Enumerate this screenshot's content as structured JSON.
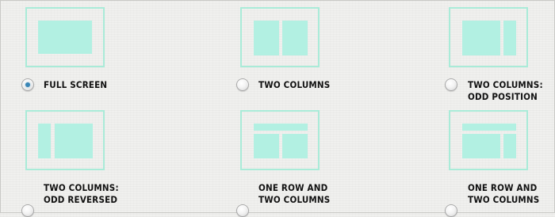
{
  "layouts": [
    {
      "label_line1": "FULL SCREEN",
      "label_line2": "",
      "selected": true
    },
    {
      "label_line1": "TWO COLUMNS",
      "label_line2": "",
      "selected": false
    },
    {
      "label_line1": "TWO COLUMNS:",
      "label_line2": "ODD POSITION",
      "selected": false
    },
    {
      "label_line1": "TWO COLUMNS:",
      "label_line2": "ODD REVERSED",
      "selected": false
    },
    {
      "label_line1": "ONE ROW AND",
      "label_line2": "TWO COLUMNS",
      "selected": false
    },
    {
      "label_line1": "ONE ROW AND",
      "label_line2": "TWO COLUMNS",
      "selected": false
    }
  ],
  "colors": {
    "thumbnail_border": "#a9ebd8",
    "thumbnail_fill": "#b2f0e2",
    "radio_selected_dot": "#3a86b6"
  }
}
